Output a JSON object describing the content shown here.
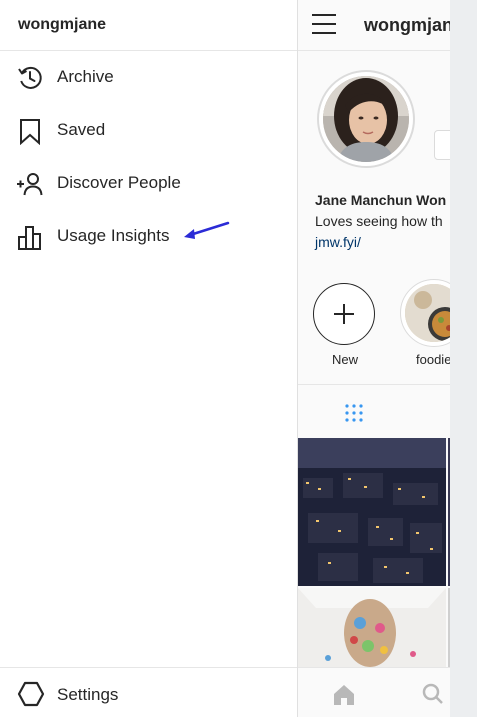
{
  "drawer": {
    "username": "wongmjane",
    "items": [
      {
        "label": "Archive",
        "icon": "archive-history-icon"
      },
      {
        "label": "Saved",
        "icon": "bookmark-icon"
      },
      {
        "label": "Discover People",
        "icon": "add-person-icon"
      },
      {
        "label": "Usage Insights",
        "icon": "bar-chart-icon"
      }
    ],
    "settings_label": "Settings",
    "annotation_arrow_color": "#2b2bd6"
  },
  "profile": {
    "username": "wongmjane",
    "full_name": "Jane Manchun Won",
    "bio": "Loves seeing how th",
    "website": "jmw.fyi/",
    "highlights": [
      {
        "label": "New"
      },
      {
        "label": "foodie"
      }
    ]
  },
  "colors": {
    "text": "#262626",
    "link": "#003569",
    "divider": "#e6e6e6",
    "profile_bg": "#fafafa"
  }
}
